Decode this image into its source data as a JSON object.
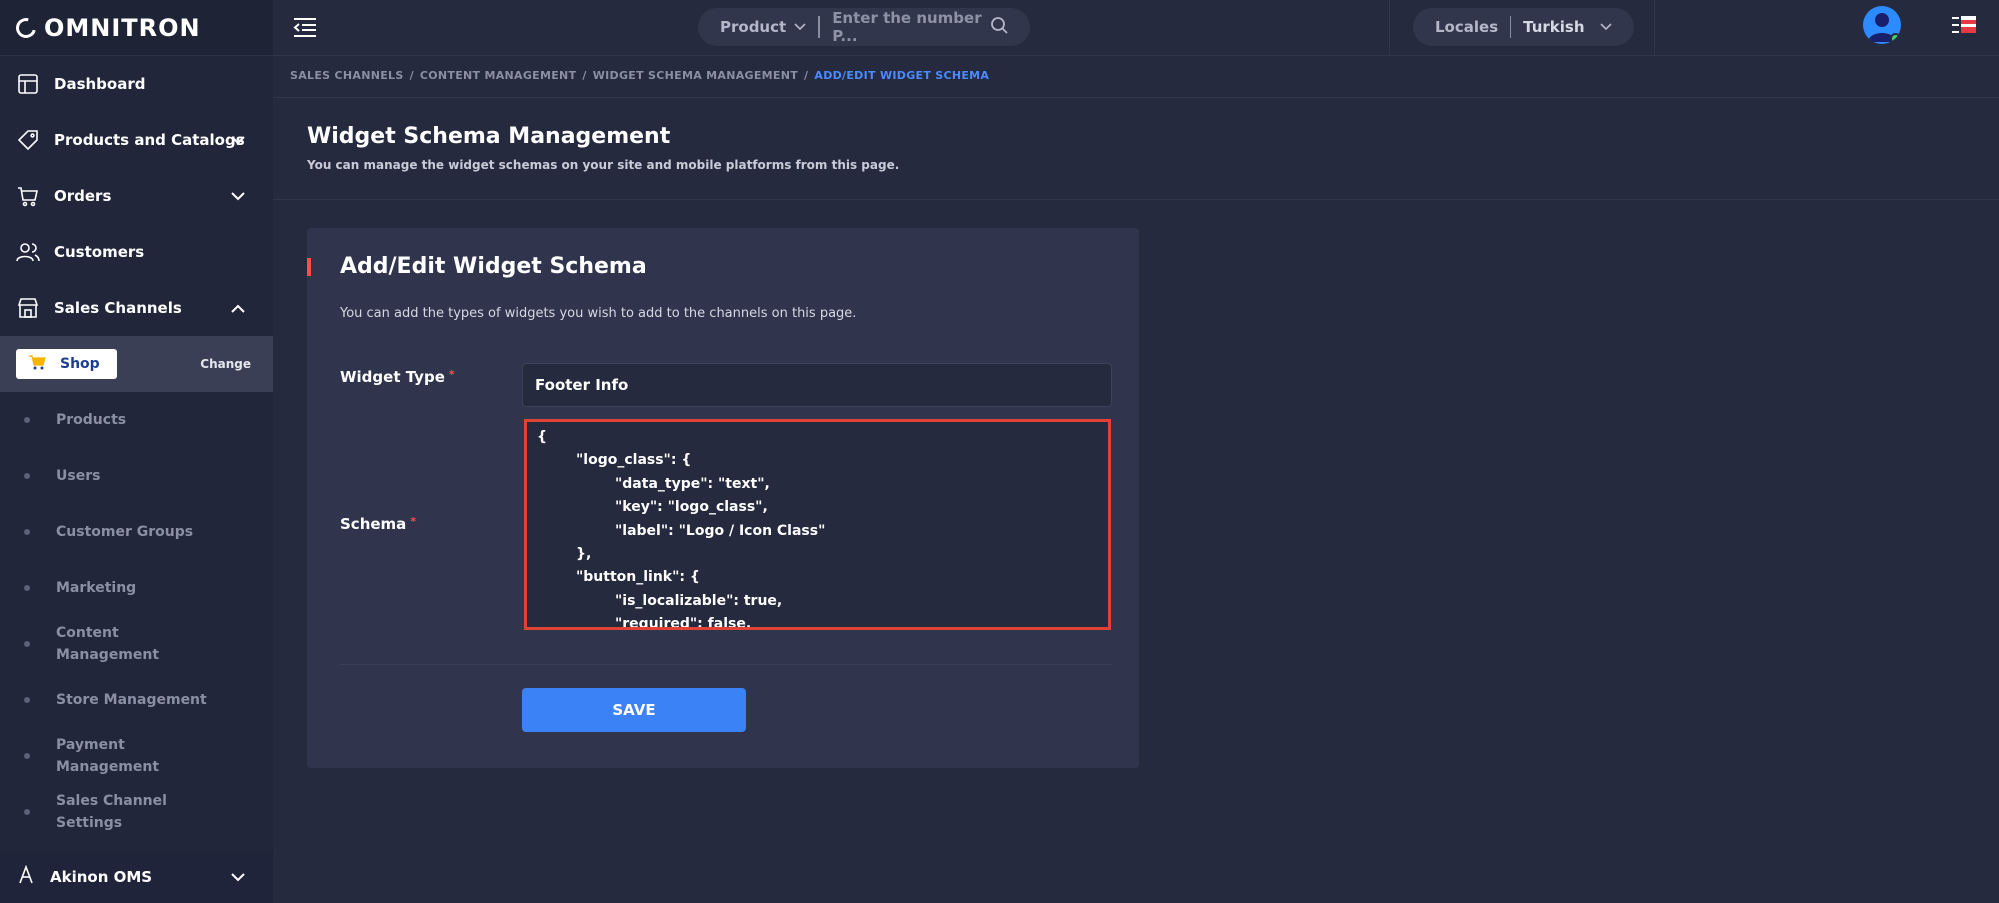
{
  "app": {
    "logo_text": "OMNITRON"
  },
  "sidebar": {
    "items": [
      {
        "label": "Dashboard",
        "icon": "dashboard-icon"
      },
      {
        "label": "Products and Catalogs",
        "icon": "tag-icon"
      },
      {
        "label": "Orders",
        "icon": "cart-icon"
      },
      {
        "label": "Customers",
        "icon": "users-icon"
      },
      {
        "label": "Sales Channels",
        "icon": "store-icon"
      }
    ],
    "channel": {
      "name": "Shop",
      "change_label": "Change"
    },
    "sub_items": [
      "Products",
      "Users",
      "Customer Groups",
      "Marketing",
      "Content Management",
      "Store Management",
      "Payment Management",
      "Sales Channel Settings"
    ],
    "bottom_item": {
      "label": "Akinon OMS",
      "icon": "oms-icon"
    }
  },
  "topbar": {
    "search_type": "Product",
    "search_placeholder": "Enter the number P...",
    "locales_label": "Locales",
    "locale_value": "Turkish"
  },
  "breadcrumb": {
    "items": [
      "SALES CHANNELS",
      "CONTENT MANAGEMENT",
      "WIDGET SCHEMA MANAGEMENT"
    ],
    "active": "ADD/EDIT WIDGET SCHEMA"
  },
  "page": {
    "title": "Widget Schema Management",
    "subtitle": "You can manage the widget schemas on your site and mobile platforms from this page."
  },
  "card": {
    "title": "Add/Edit Widget Schema",
    "description": "You can add the types of widgets you wish to add to the channels on this page.",
    "widget_type_label": "Widget Type",
    "widget_type_value": "Footer Info",
    "schema_label": "Schema",
    "schema_value": "{\n        \"logo_class\": {\n                \"data_type\": \"text\",\n                \"key\": \"logo_class\",\n                \"label\": \"Logo / Icon Class\"\n        },\n        \"button_link\": {\n                \"is_localizable\": true,\n                \"required\": false,",
    "save_label": "SAVE"
  },
  "colors": {
    "accent": "#3b82f6",
    "required": "#ff4d4d",
    "highlight_border": "#e04335"
  }
}
